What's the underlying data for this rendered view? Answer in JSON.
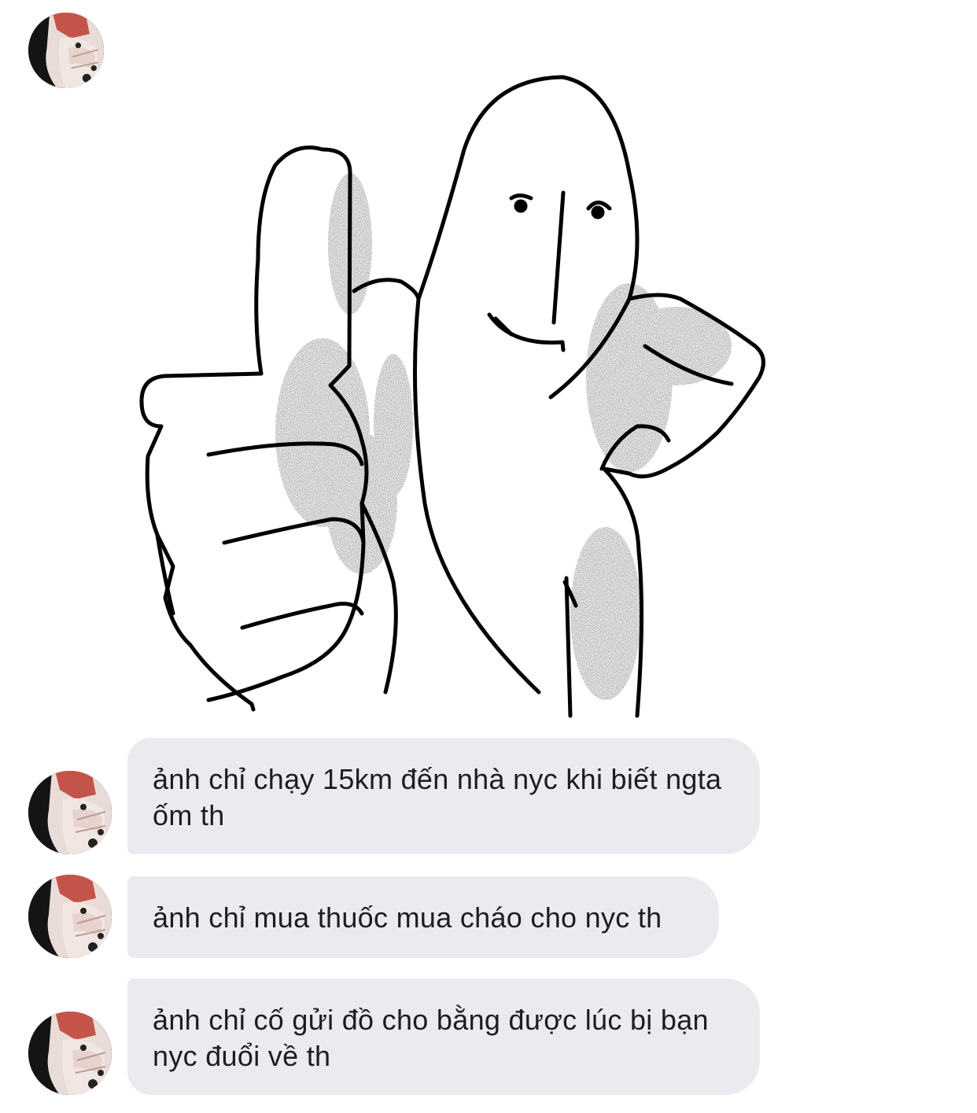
{
  "conversation": {
    "sender": {
      "avatar_icon": "profile-photo-avatar"
    },
    "sticker": {
      "icon": "thumbs-up-meme-sticker"
    },
    "messages": [
      {
        "text": "ảnh chỉ chạy 15km đến nhà nyc khi biết ngta ốm th"
      },
      {
        "text": "ảnh chỉ mua thuốc mua cháo cho nyc th"
      },
      {
        "text": "ảnh chỉ cố gửi đồ cho bằng được lúc bị bạn nyc đuổi về th"
      }
    ]
  },
  "colors": {
    "background": "#ffffff",
    "bubble": "#e9ebee",
    "text": "#1c1e21"
  }
}
